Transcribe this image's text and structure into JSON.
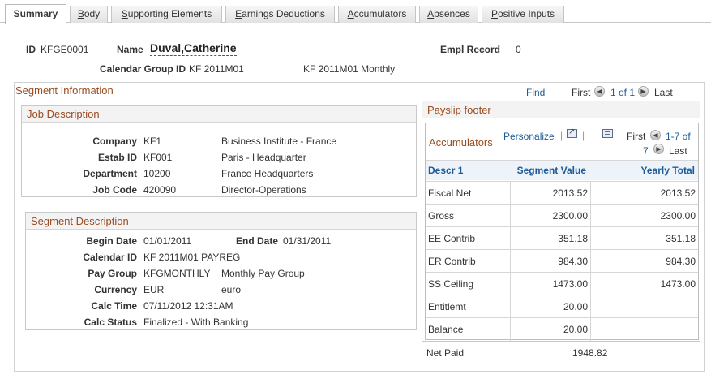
{
  "tabs": [
    {
      "label": "Summary",
      "active": true
    },
    {
      "label": "Body",
      "underline": "B",
      "rest": "ody"
    },
    {
      "label": "Supporting Elements",
      "underline": "S",
      "rest": "upporting Elements"
    },
    {
      "label": "Earnings Deductions",
      "underline": "E",
      "rest": "arnings Deductions"
    },
    {
      "label": "Accumulators",
      "underline": "A",
      "rest": "ccumulators"
    },
    {
      "label": "Absences",
      "underline": "A",
      "rest": "bsences"
    },
    {
      "label": "Positive Inputs",
      "underline": "P",
      "rest": "ositive Inputs"
    }
  ],
  "header": {
    "id_label": "ID",
    "id_value": "KFGE0001",
    "name_label": "Name",
    "name_value": "Duval,Catherine",
    "empl_record_label": "Empl Record",
    "empl_record_value": "0",
    "calendar_group_label": "Calendar Group ID",
    "calendar_group_value": "KF 2011M01",
    "calendar_group_desc": "KF 2011M01 Monthly"
  },
  "segment": {
    "title": "Segment Information",
    "find": "Find",
    "first": "First",
    "range": "1 of 1",
    "last": "Last"
  },
  "job": {
    "title": "Job Description",
    "rows": [
      {
        "label": "Company",
        "code": "KF1",
        "desc": "Business Institute - France"
      },
      {
        "label": "Estab ID",
        "code": "KF001",
        "desc": "Paris - Headquarter"
      },
      {
        "label": "Department",
        "code": "10200",
        "desc": "France Headquarters"
      },
      {
        "label": "Job Code",
        "code": "420090",
        "desc": "Director-Operations"
      }
    ]
  },
  "segdesc": {
    "title": "Segment Description",
    "begin_label": "Begin Date",
    "begin_value": "01/01/2011",
    "end_label": "End Date",
    "end_value": "01/31/2011",
    "calendar_label": "Calendar ID",
    "calendar_value": "KF 2011M01 PAYREG",
    "paygroup_label": "Pay Group",
    "paygroup_value": "KFGMONTHLY",
    "paygroup_desc": "Monthly Pay Group",
    "currency_label": "Currency",
    "currency_value": "EUR",
    "currency_desc": "euro",
    "calctime_label": "Calc Time",
    "calctime_value": "07/11/2012 12:31AM",
    "calcstatus_label": "Calc Status",
    "calcstatus_value": "Finalized - With Banking"
  },
  "payslip": {
    "title": "Payslip footer",
    "accumulators_title": "Accumulators",
    "personalize": "Personalize",
    "first": "First",
    "range_a": "1-7 of",
    "range_b": "7",
    "last": "Last",
    "columns": [
      "Descr 1",
      "Segment Value",
      "Yearly Total"
    ],
    "rows": [
      {
        "descr": "Fiscal Net",
        "segment": "2013.52",
        "yearly": "2013.52"
      },
      {
        "descr": "Gross",
        "segment": "2300.00",
        "yearly": "2300.00"
      },
      {
        "descr": "EE Contrib",
        "segment": "351.18",
        "yearly": "351.18"
      },
      {
        "descr": "ER Contrib",
        "segment": "984.30",
        "yearly": "984.30"
      },
      {
        "descr": "SS Ceiling",
        "segment": "1473.00",
        "yearly": "1473.00"
      },
      {
        "descr": "Entitlemt",
        "segment": "20.00",
        "yearly": ""
      },
      {
        "descr": "Balance",
        "segment": "20.00",
        "yearly": ""
      }
    ],
    "net_paid_label": "Net Paid",
    "net_paid_value": "1948.82"
  },
  "colors": {
    "accent": "#1c5b97",
    "section_title": "#9a4b1f",
    "border": "#c9c9c9"
  },
  "icons": {
    "prev": "chevron-left-icon",
    "next": "chevron-right-icon",
    "zoom": "zoom-icon",
    "download": "spreadsheet-icon"
  }
}
